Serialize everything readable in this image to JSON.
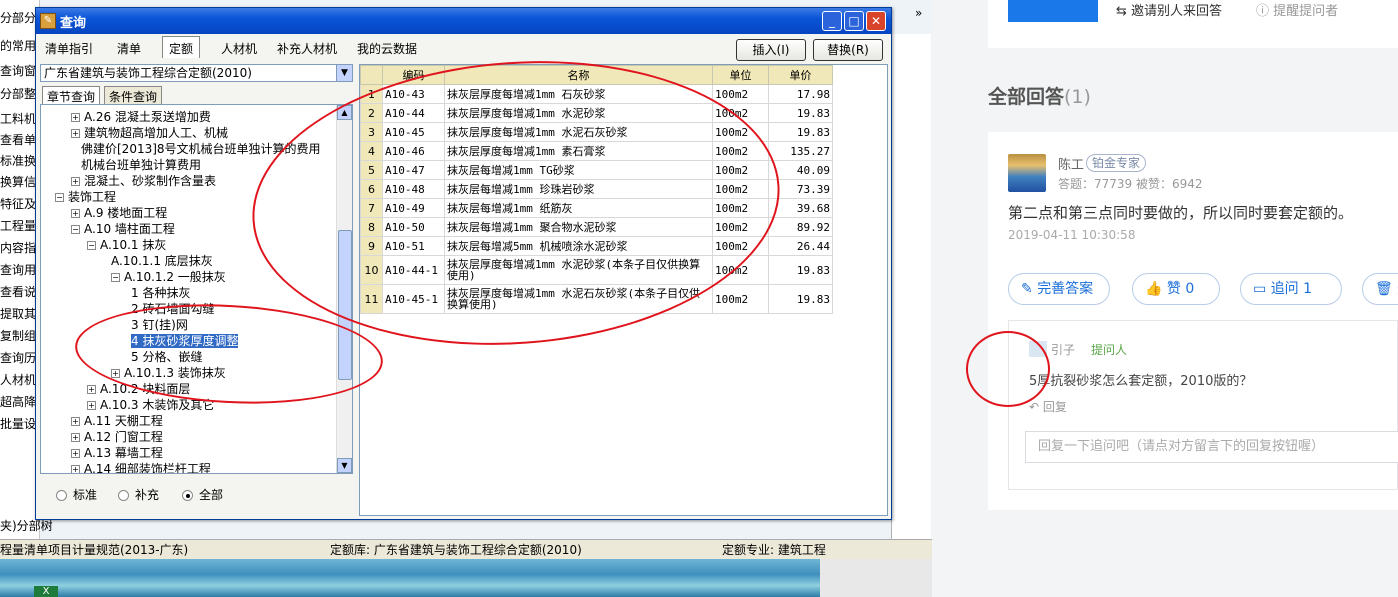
{
  "bg_app": {
    "top_tab": "分部分",
    "arrow": "»",
    "side_items": [
      "的常用",
      "查询窗",
      "分部整",
      "工料机",
      "查看单",
      "标准换",
      "换算信",
      "特征及",
      "工程量",
      "内容指",
      "查询用",
      "查看说",
      "提取其",
      "复制组",
      "查询历",
      "人材机",
      "超高降",
      "批量设"
    ],
    "bottom_tabs": "夹)分部树",
    "status": {
      "left": "程量清单项目计量规范(2013-广东)",
      "mid": "定额库: 广东省建筑与装饰工程综合定额(2010)",
      "right": "定额专业: 建筑工程"
    },
    "excel_icon": "X"
  },
  "dialog": {
    "title": "查询",
    "icon": "app-icon",
    "win_buttons": {
      "minimize": "_",
      "maximize": "□",
      "close": "✕"
    },
    "top_tabs": [
      "清单指引",
      "清单",
      "定额",
      "人材机",
      "补充人材机",
      "我的云数据"
    ],
    "active_tab": "定额",
    "insert_btn": "插入(I)",
    "replace_btn": "替换(R)",
    "library": "广东省建筑与装饰工程综合定额(2010)",
    "subtabs": [
      "章节查询",
      "条件查询"
    ],
    "tree": [
      {
        "label": "A.26 混凝土泵送增加费",
        "exp": "+"
      },
      {
        "label": "建筑物超高增加人工、机械",
        "exp": "+"
      },
      {
        "label": "佛建价[2013]8号文机械台班单独计算的费用",
        "exp": ""
      },
      {
        "label": "机械台班单独计算费用",
        "exp": ""
      },
      {
        "label": "混凝土、砂浆制作含量表",
        "exp": "+"
      },
      {
        "label": "装饰工程",
        "exp": "−"
      },
      {
        "label": "A.9 楼地面工程",
        "exp": "+"
      },
      {
        "label": "A.10 墙柱面工程",
        "exp": "−"
      },
      {
        "label": "A.10.1 抹灰",
        "exp": "−"
      },
      {
        "label": "A.10.1.1 底层抹灰",
        "exp": ""
      },
      {
        "label": "A.10.1.2 一般抹灰",
        "exp": "−"
      },
      {
        "label": "1 各种抹灰",
        "exp": ""
      },
      {
        "label": "2 砖石墙面勾缝",
        "exp": ""
      },
      {
        "label": "3 钉(挂)网",
        "exp": ""
      },
      {
        "label": "4 抹灰砂浆厚度调整",
        "exp": ""
      },
      {
        "label": "5 分格、嵌缝",
        "exp": ""
      },
      {
        "label": "A.10.1.3 装饰抹灰",
        "exp": "+"
      },
      {
        "label": "A.10.2 块料面层",
        "exp": "+"
      },
      {
        "label": "A.10.3 木装饰及其它",
        "exp": "+"
      },
      {
        "label": "A.11 天棚工程",
        "exp": "+"
      },
      {
        "label": "A.12 门窗工程",
        "exp": "+"
      },
      {
        "label": "A.13 幕墙工程",
        "exp": "+"
      },
      {
        "label": "A.14 细部装饰栏杆工程",
        "exp": "+"
      }
    ],
    "radios": [
      "标准",
      "补充",
      "全部"
    ],
    "selected_radio": "全部",
    "grid": {
      "headers": [
        "编码",
        "名称",
        "单位",
        "单价"
      ],
      "rows": [
        {
          "n": "1",
          "code": "A10-43",
          "name": "抹灰层厚度每增减1mm 石灰砂浆",
          "unit": "100m2",
          "price": "17.98"
        },
        {
          "n": "2",
          "code": "A10-44",
          "name": "抹灰层厚度每增减1mm 水泥砂浆",
          "unit": "100m2",
          "price": "19.83"
        },
        {
          "n": "3",
          "code": "A10-45",
          "name": "抹灰层厚度每增减1mm 水泥石灰砂浆",
          "unit": "100m2",
          "price": "19.83"
        },
        {
          "n": "4",
          "code": "A10-46",
          "name": "抹灰层厚度每增减1mm 素石膏浆",
          "unit": "100m2",
          "price": "135.27"
        },
        {
          "n": "5",
          "code": "A10-47",
          "name": "抹灰层每增减1mm TG砂浆",
          "unit": "100m2",
          "price": "40.09"
        },
        {
          "n": "6",
          "code": "A10-48",
          "name": "抹灰层每增减1mm 珍珠岩砂浆",
          "unit": "100m2",
          "price": "73.39"
        },
        {
          "n": "7",
          "code": "A10-49",
          "name": "抹灰层每增减1mm 纸筋灰",
          "unit": "100m2",
          "price": "39.68"
        },
        {
          "n": "8",
          "code": "A10-50",
          "name": "抹灰层每增减1mm 聚合物水泥砂浆",
          "unit": "100m2",
          "price": "89.92"
        },
        {
          "n": "9",
          "code": "A10-51",
          "name": "抹灰层每增减5mm 机械喷涂水泥砂浆",
          "unit": "100m2",
          "price": "26.44"
        },
        {
          "n": "10",
          "code": "A10-44-1",
          "name": "抹灰层厚度每增减1mm 水泥砂浆(本条子目仅供换算使用)",
          "unit": "100m2",
          "price": "19.83"
        },
        {
          "n": "11",
          "code": "A10-45-1",
          "name": "抹灰层厚度每增减1mm 水泥石灰砂浆(本条子目仅供换算使用)",
          "unit": "100m2",
          "price": "19.83"
        }
      ]
    }
  },
  "web": {
    "top_link": "邀请别人来回答",
    "top_link2": "提醒提问者",
    "answers_title": "全部回答",
    "answers_count": "(1)",
    "author": "陈工",
    "badge": "铂金专家",
    "stats": "答题：77739    被赞：6942",
    "answer": "第二点和第三点同时要做的，所以同时要套定额的。",
    "time": "2019-04-11 10:30:58",
    "buttons": {
      "complete": "完善答案",
      "like": "赞 0",
      "followup": "追问 1",
      "delete": "删"
    },
    "followup": {
      "name": "引子",
      "tag": "提问人",
      "text": "5厚抗裂砂浆怎么套定额，2010版的？",
      "reply": "回复",
      "placeholder": "回复一下追问吧（请点对方留言下的回复按钮喔）"
    }
  },
  "colors": {
    "annotation": "#e0141c",
    "title_bar": "#0a54d8",
    "selection": "#316ac5",
    "link_blue": "#1a6ed8"
  }
}
